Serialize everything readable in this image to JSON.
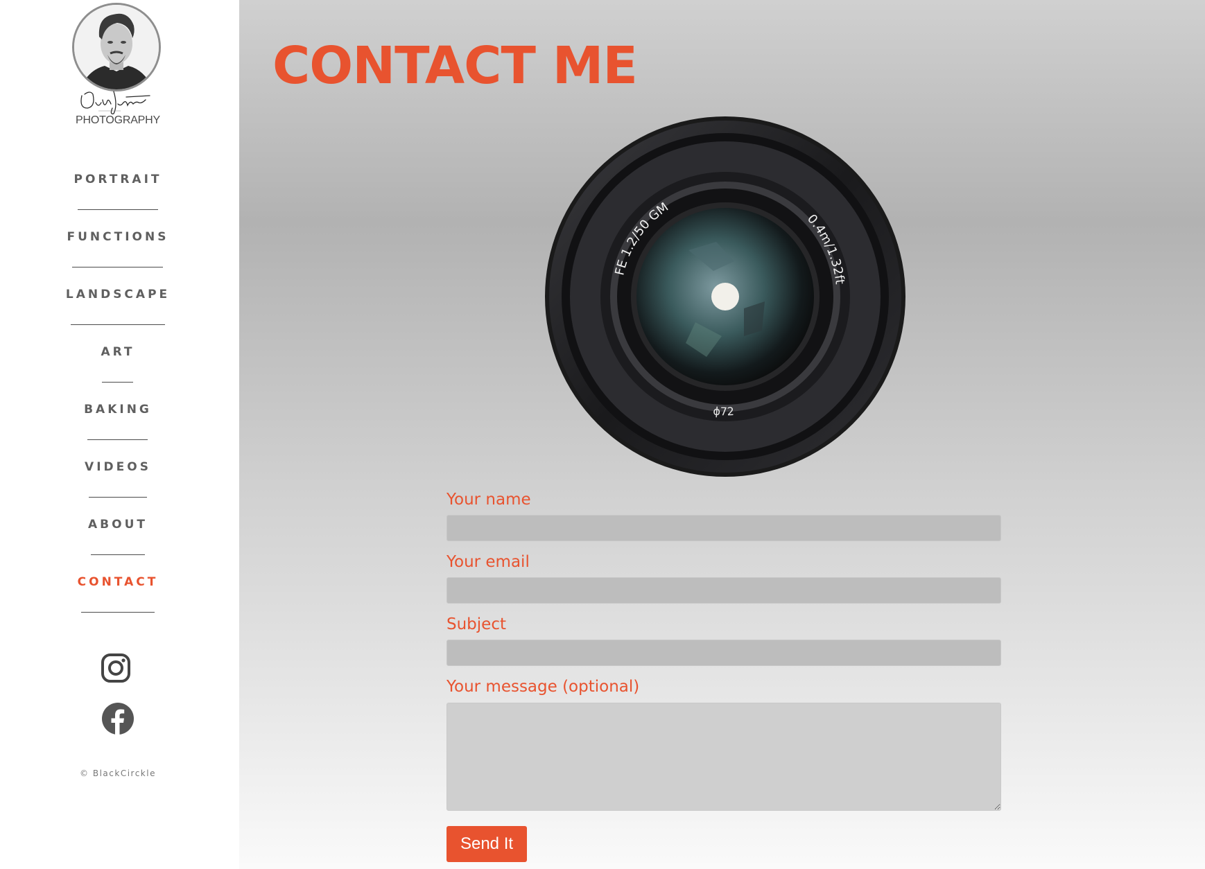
{
  "sidebar": {
    "brand": "PHOTOGRAPHY",
    "nav": [
      {
        "label": "PORTRAIT"
      },
      {
        "label": "FUNCTIONS"
      },
      {
        "label": "LANDSCAPE"
      },
      {
        "label": "ART"
      },
      {
        "label": "BAKING"
      },
      {
        "label": "VIDEOS"
      },
      {
        "label": "ABOUT"
      },
      {
        "label": "CONTACT",
        "active": true
      }
    ],
    "social": [
      "instagram-icon",
      "facebook-icon"
    ],
    "copyright": "© BlackCirckle"
  },
  "main": {
    "title": "CONTACT ME",
    "lens": {
      "model_text": "FE 1.2/50 GM",
      "distance_text": "0.4m/1.32ft",
      "filter_text": "ϕ72"
    },
    "form": {
      "name_label": "Your name",
      "name_value": "",
      "email_label": "Your email",
      "email_value": "",
      "subject_label": "Subject",
      "subject_value": "",
      "message_label": "Your message (optional)",
      "message_value": "",
      "submit_label": "Send It"
    }
  },
  "colors": {
    "accent": "#e8532f",
    "nav_text": "#5f5f5f",
    "input_bg": "#bdbdbd"
  }
}
